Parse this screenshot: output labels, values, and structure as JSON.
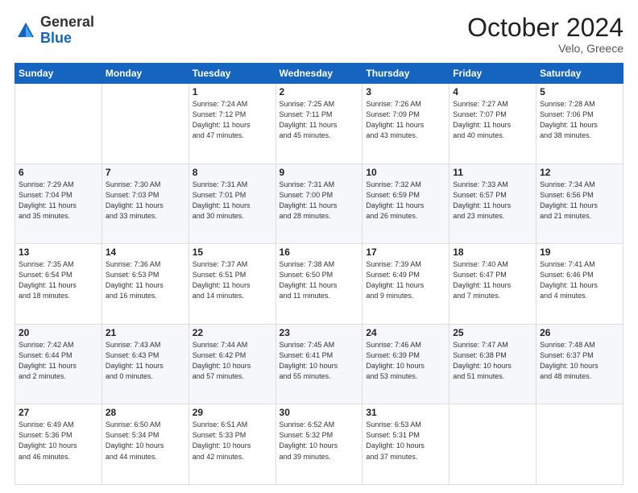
{
  "header": {
    "logo_general": "General",
    "logo_blue": "Blue",
    "month_title": "October 2024",
    "location": "Velo, Greece"
  },
  "weekdays": [
    "Sunday",
    "Monday",
    "Tuesday",
    "Wednesday",
    "Thursday",
    "Friday",
    "Saturday"
  ],
  "weeks": [
    [
      {
        "day": "",
        "info": ""
      },
      {
        "day": "",
        "info": ""
      },
      {
        "day": "1",
        "info": "Sunrise: 7:24 AM\nSunset: 7:12 PM\nDaylight: 11 hours\nand 47 minutes."
      },
      {
        "day": "2",
        "info": "Sunrise: 7:25 AM\nSunset: 7:11 PM\nDaylight: 11 hours\nand 45 minutes."
      },
      {
        "day": "3",
        "info": "Sunrise: 7:26 AM\nSunset: 7:09 PM\nDaylight: 11 hours\nand 43 minutes."
      },
      {
        "day": "4",
        "info": "Sunrise: 7:27 AM\nSunset: 7:07 PM\nDaylight: 11 hours\nand 40 minutes."
      },
      {
        "day": "5",
        "info": "Sunrise: 7:28 AM\nSunset: 7:06 PM\nDaylight: 11 hours\nand 38 minutes."
      }
    ],
    [
      {
        "day": "6",
        "info": "Sunrise: 7:29 AM\nSunset: 7:04 PM\nDaylight: 11 hours\nand 35 minutes."
      },
      {
        "day": "7",
        "info": "Sunrise: 7:30 AM\nSunset: 7:03 PM\nDaylight: 11 hours\nand 33 minutes."
      },
      {
        "day": "8",
        "info": "Sunrise: 7:31 AM\nSunset: 7:01 PM\nDaylight: 11 hours\nand 30 minutes."
      },
      {
        "day": "9",
        "info": "Sunrise: 7:31 AM\nSunset: 7:00 PM\nDaylight: 11 hours\nand 28 minutes."
      },
      {
        "day": "10",
        "info": "Sunrise: 7:32 AM\nSunset: 6:59 PM\nDaylight: 11 hours\nand 26 minutes."
      },
      {
        "day": "11",
        "info": "Sunrise: 7:33 AM\nSunset: 6:57 PM\nDaylight: 11 hours\nand 23 minutes."
      },
      {
        "day": "12",
        "info": "Sunrise: 7:34 AM\nSunset: 6:56 PM\nDaylight: 11 hours\nand 21 minutes."
      }
    ],
    [
      {
        "day": "13",
        "info": "Sunrise: 7:35 AM\nSunset: 6:54 PM\nDaylight: 11 hours\nand 18 minutes."
      },
      {
        "day": "14",
        "info": "Sunrise: 7:36 AM\nSunset: 6:53 PM\nDaylight: 11 hours\nand 16 minutes."
      },
      {
        "day": "15",
        "info": "Sunrise: 7:37 AM\nSunset: 6:51 PM\nDaylight: 11 hours\nand 14 minutes."
      },
      {
        "day": "16",
        "info": "Sunrise: 7:38 AM\nSunset: 6:50 PM\nDaylight: 11 hours\nand 11 minutes."
      },
      {
        "day": "17",
        "info": "Sunrise: 7:39 AM\nSunset: 6:49 PM\nDaylight: 11 hours\nand 9 minutes."
      },
      {
        "day": "18",
        "info": "Sunrise: 7:40 AM\nSunset: 6:47 PM\nDaylight: 11 hours\nand 7 minutes."
      },
      {
        "day": "19",
        "info": "Sunrise: 7:41 AM\nSunset: 6:46 PM\nDaylight: 11 hours\nand 4 minutes."
      }
    ],
    [
      {
        "day": "20",
        "info": "Sunrise: 7:42 AM\nSunset: 6:44 PM\nDaylight: 11 hours\nand 2 minutes."
      },
      {
        "day": "21",
        "info": "Sunrise: 7:43 AM\nSunset: 6:43 PM\nDaylight: 11 hours\nand 0 minutes."
      },
      {
        "day": "22",
        "info": "Sunrise: 7:44 AM\nSunset: 6:42 PM\nDaylight: 10 hours\nand 57 minutes."
      },
      {
        "day": "23",
        "info": "Sunrise: 7:45 AM\nSunset: 6:41 PM\nDaylight: 10 hours\nand 55 minutes."
      },
      {
        "day": "24",
        "info": "Sunrise: 7:46 AM\nSunset: 6:39 PM\nDaylight: 10 hours\nand 53 minutes."
      },
      {
        "day": "25",
        "info": "Sunrise: 7:47 AM\nSunset: 6:38 PM\nDaylight: 10 hours\nand 51 minutes."
      },
      {
        "day": "26",
        "info": "Sunrise: 7:48 AM\nSunset: 6:37 PM\nDaylight: 10 hours\nand 48 minutes."
      }
    ],
    [
      {
        "day": "27",
        "info": "Sunrise: 6:49 AM\nSunset: 5:36 PM\nDaylight: 10 hours\nand 46 minutes."
      },
      {
        "day": "28",
        "info": "Sunrise: 6:50 AM\nSunset: 5:34 PM\nDaylight: 10 hours\nand 44 minutes."
      },
      {
        "day": "29",
        "info": "Sunrise: 6:51 AM\nSunset: 5:33 PM\nDaylight: 10 hours\nand 42 minutes."
      },
      {
        "day": "30",
        "info": "Sunrise: 6:52 AM\nSunset: 5:32 PM\nDaylight: 10 hours\nand 39 minutes."
      },
      {
        "day": "31",
        "info": "Sunrise: 6:53 AM\nSunset: 5:31 PM\nDaylight: 10 hours\nand 37 minutes."
      },
      {
        "day": "",
        "info": ""
      },
      {
        "day": "",
        "info": ""
      }
    ]
  ]
}
